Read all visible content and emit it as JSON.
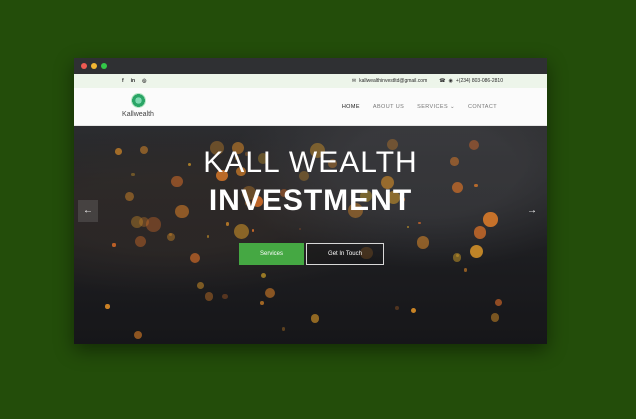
{
  "topbar": {
    "social": [
      "f",
      "in",
      "◎"
    ],
    "email": "kallwealthinvestltd@gmail.com",
    "phone": "+(234) 803-086-2810"
  },
  "brand": {
    "name": "Kallwealth"
  },
  "nav": {
    "items": [
      "HOME",
      "ABOUT US",
      "SERVICES",
      "CONTACT"
    ],
    "active": "HOME"
  },
  "hero": {
    "title_line1": "KALL WEALTH",
    "title_line2": "INVESTMENT",
    "primary_button": "Services",
    "secondary_button": "Get In Touch",
    "prev_icon": "arrow-left-icon",
    "next_icon": "arrow-right-icon"
  },
  "colors": {
    "background": "#234d0a",
    "accent": "#45a843",
    "topbar": "#edf5ea"
  }
}
